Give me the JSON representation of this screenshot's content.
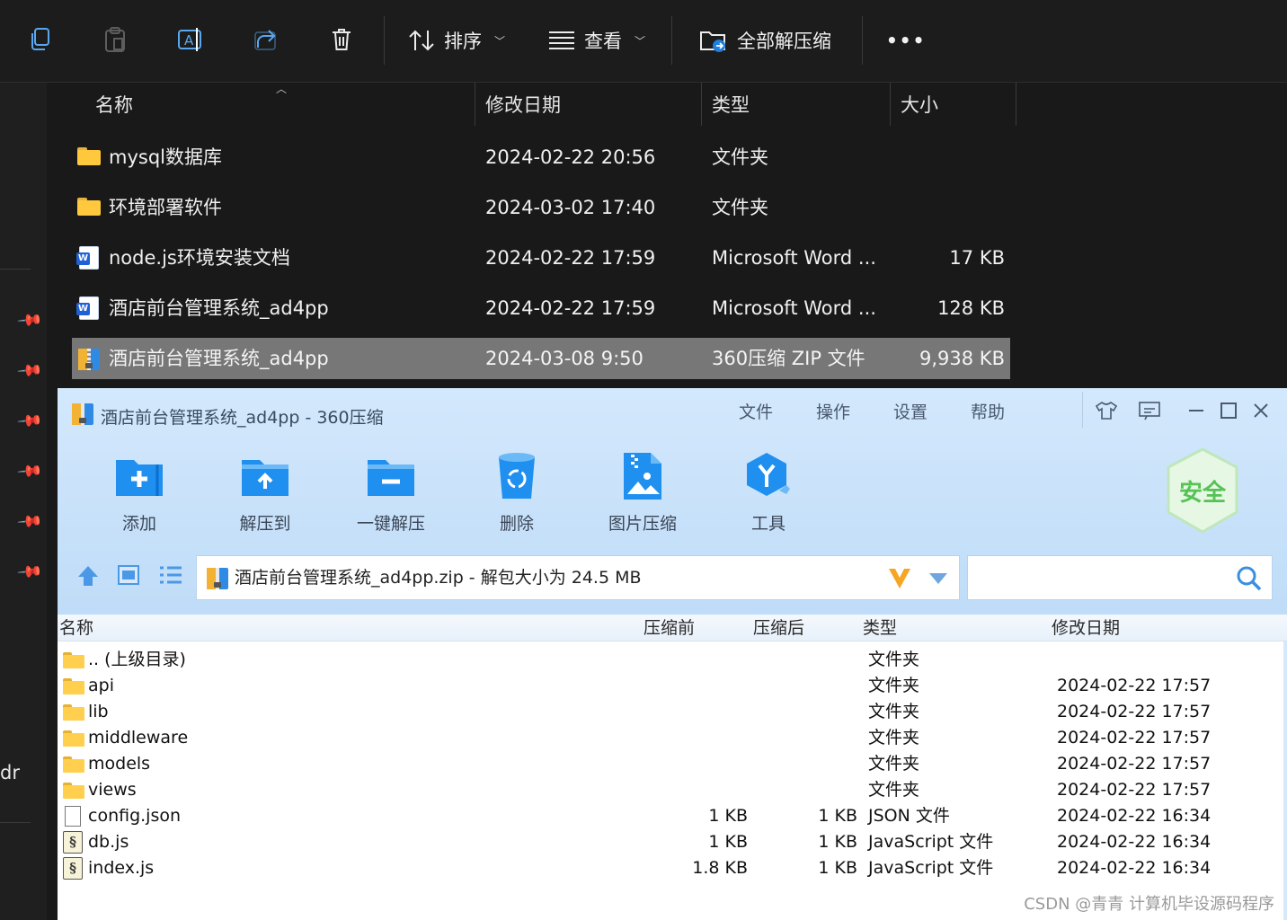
{
  "toolbar": {
    "sort_label": "排序",
    "view_label": "查看",
    "extract_all_label": "全部解压缩",
    "more_label": "•••"
  },
  "left_nav": {
    "partial_text": "dr"
  },
  "explorer": {
    "columns": {
      "name": "名称",
      "modified": "修改日期",
      "type": "类型",
      "size": "大小"
    },
    "rows": [
      {
        "icon": "folder-icon",
        "name": "mysql数据库",
        "modified": "2024-02-22 20:56",
        "type": "文件夹",
        "size": ""
      },
      {
        "icon": "folder-icon",
        "name": "环境部署软件",
        "modified": "2024-03-02 17:40",
        "type": "文件夹",
        "size": ""
      },
      {
        "icon": "word-doc-icon",
        "name": "node.js环境安装文档",
        "modified": "2024-02-22 17:59",
        "type": "Microsoft Word ...",
        "size": "17 KB"
      },
      {
        "icon": "word-doc-icon",
        "name": "酒店前台管理系统_ad4pp",
        "modified": "2024-02-22 17:59",
        "type": "Microsoft Word ...",
        "size": "128 KB"
      },
      {
        "icon": "zip-archive-icon",
        "name": "酒店前台管理系统_ad4pp",
        "modified": "2024-03-08 9:50",
        "type": "360压缩 ZIP 文件",
        "size": "9,938 KB",
        "selected": true
      }
    ]
  },
  "zip_window": {
    "title": "酒店前台管理系统_ad4pp - 360压缩",
    "menu": [
      "文件",
      "操作",
      "设置",
      "帮助"
    ],
    "tools": [
      {
        "label": "添加",
        "icon": "add-folder-icon"
      },
      {
        "label": "解压到",
        "icon": "extract-to-folder-icon"
      },
      {
        "label": "一键解压",
        "icon": "one-click-extract-icon"
      },
      {
        "label": "删除",
        "icon": "recycle-bin-icon"
      },
      {
        "label": "图片压缩",
        "icon": "image-compress-icon"
      },
      {
        "label": "工具",
        "icon": "tools-hex-icon"
      }
    ],
    "safe_badge": "安全",
    "path_text": "酒店前台管理系统_ad4pp.zip - 解包大小为 24.5 MB",
    "columns": {
      "name": "名称",
      "before": "压缩前",
      "after": "压缩后",
      "type": "类型",
      "modified": "修改日期"
    },
    "rows": [
      {
        "icon": "folder",
        "name": ".. (上级目录)",
        "before": "",
        "after": "",
        "type": "文件夹",
        "modified": ""
      },
      {
        "icon": "folder",
        "name": "api",
        "before": "",
        "after": "",
        "type": "文件夹",
        "modified": "2024-02-22 17:57"
      },
      {
        "icon": "folder",
        "name": "lib",
        "before": "",
        "after": "",
        "type": "文件夹",
        "modified": "2024-02-22 17:57"
      },
      {
        "icon": "folder",
        "name": "middleware",
        "before": "",
        "after": "",
        "type": "文件夹",
        "modified": "2024-02-22 17:57"
      },
      {
        "icon": "folder",
        "name": "models",
        "before": "",
        "after": "",
        "type": "文件夹",
        "modified": "2024-02-22 17:57"
      },
      {
        "icon": "folder",
        "name": "views",
        "before": "",
        "after": "",
        "type": "文件夹",
        "modified": "2024-02-22 17:57"
      },
      {
        "icon": "file",
        "name": "config.json",
        "before": "1 KB",
        "after": "1 KB",
        "type": "JSON 文件",
        "modified": "2024-02-22 16:34"
      },
      {
        "icon": "script",
        "name": "db.js",
        "before": "1 KB",
        "after": "1 KB",
        "type": "JavaScript 文件",
        "modified": "2024-02-22 16:34"
      },
      {
        "icon": "script",
        "name": "index.js",
        "before": "1.8 KB",
        "after": "1 KB",
        "type": "JavaScript 文件",
        "modified": "2024-02-22 16:34"
      }
    ]
  },
  "watermark": "CSDN @青青  计算机毕设源码程序",
  "colors": {
    "accent_blue": "#1f8ff0",
    "selection": "#777777",
    "zip_bg": "#d3e8fc",
    "safe_green": "#5cc55b"
  }
}
